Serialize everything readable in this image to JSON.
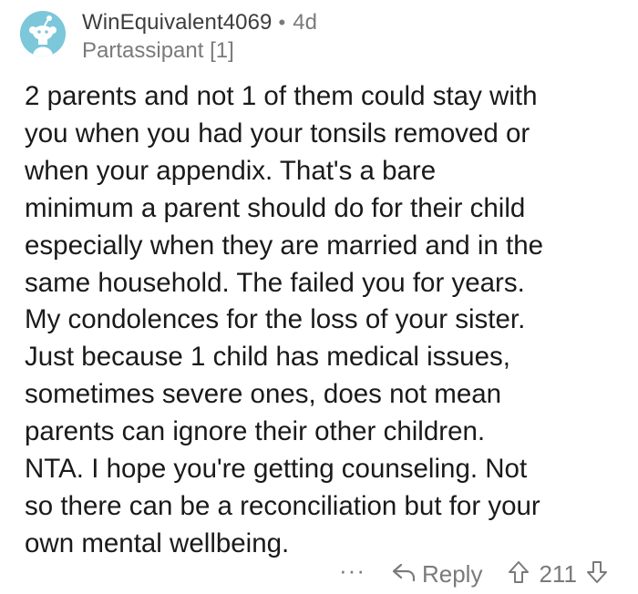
{
  "comment": {
    "author": {
      "username": "WinEquivalent4069",
      "separator": "•",
      "age": "4d",
      "flair": "Partassipant [1]",
      "avatar_icon": "snoo-avatar-icon",
      "avatar_color": "#7cc7d9"
    },
    "body_lines": [
      "2 parents and not 1 of them could stay with",
      "you when you had your tonsils removed or",
      "when your appendix. That's a bare",
      "minimum a parent should do for their child",
      "especially when they are married and in the",
      "same household. The failed you for years.",
      "My condolences for the loss of your sister.",
      "Just because 1 child has medical issues,",
      "sometimes severe ones, does not mean",
      "parents can ignore their other children.",
      "NTA. I hope you're getting counseling. Not",
      "so there can be a reconciliation but for your",
      "own mental wellbeing."
    ],
    "actions": {
      "more_label": "···",
      "reply_label": "Reply",
      "reply_icon": "reply-arrow-icon",
      "upvote_icon": "upvote-arrow-icon",
      "score": "211",
      "downvote_icon": "downvote-arrow-icon"
    },
    "colors": {
      "text": "#1a1a1a",
      "muted": "#7a7a7a"
    }
  }
}
